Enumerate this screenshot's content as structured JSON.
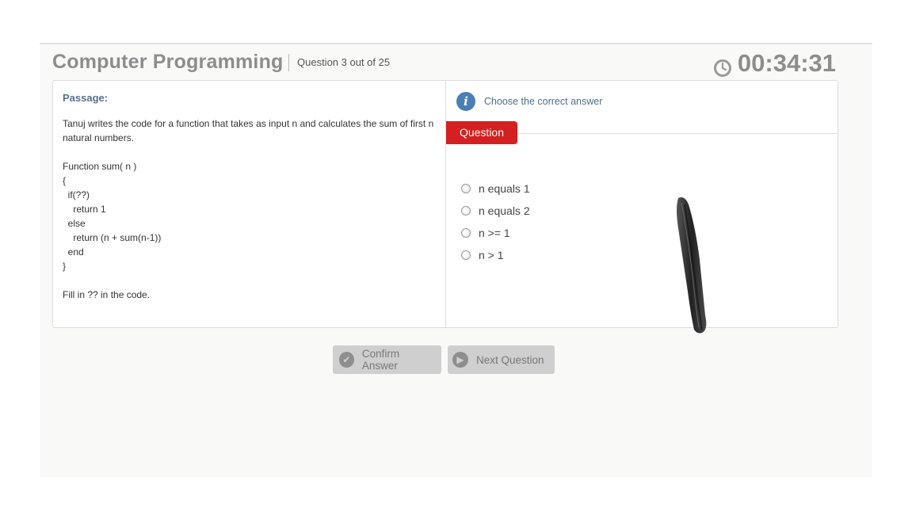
{
  "header": {
    "title": "Computer Programming",
    "question_count": "Question 3 out of 25",
    "timer": "00:34:31"
  },
  "passage": {
    "label": "Passage:",
    "intro": "Tanuj writes the code for a function that takes as input n and calculates the sum of first n natural numbers.",
    "code_lines": [
      "Function sum( n )",
      "{",
      "  if(??)",
      "    return 1",
      "  else",
      "    return (n + sum(n-1))",
      "  end",
      "}"
    ],
    "instruction": "Fill in ?? in the code."
  },
  "question": {
    "instruction": "Choose the correct answer",
    "tab_label": "Question",
    "options": [
      "n equals 1",
      "n equals 2",
      "n >= 1",
      "n > 1"
    ]
  },
  "buttons": {
    "confirm": "Confirm Answer",
    "next": "Next Question"
  },
  "icons": {
    "timer": "clock-icon",
    "info": "info-icon",
    "confirm": "check-circle-icon",
    "next": "play-circle-icon"
  },
  "colors": {
    "question_tab": "#d42020",
    "info_icon": "#4a7fb5",
    "title": "#8d8d8d"
  }
}
